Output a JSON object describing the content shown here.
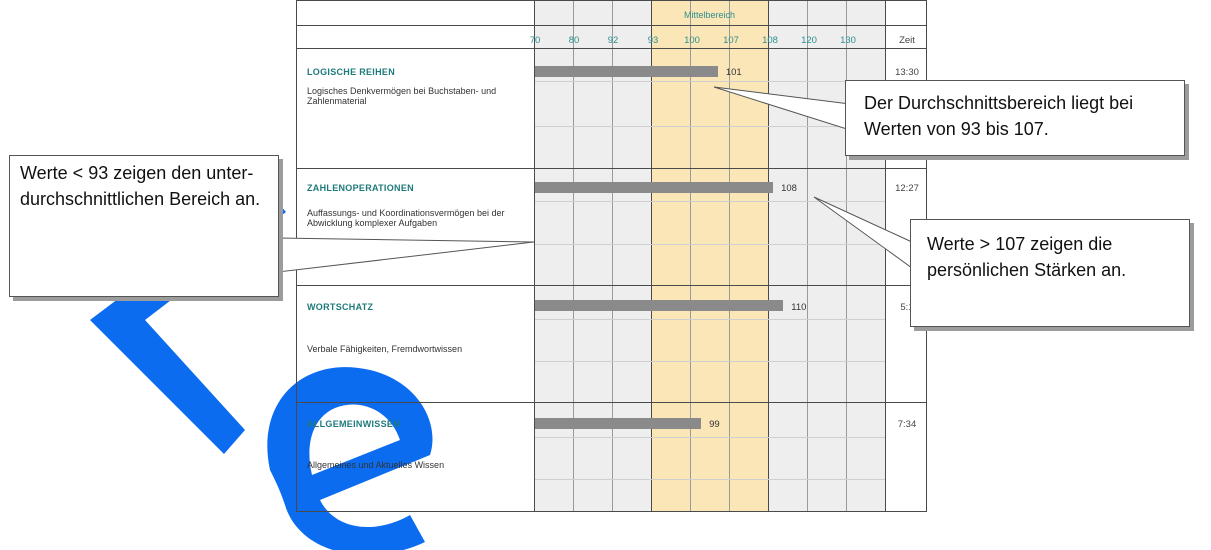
{
  "watermark": {
    "letters": "Le",
    "color": "#0b6cf0"
  },
  "table": {
    "header_band_label": "Mittelbereich",
    "zeit_label": "Zeit",
    "tick_labels": [
      "70",
      "80",
      "92",
      "93",
      "100",
      "107",
      "108",
      "120",
      "130"
    ]
  },
  "chart_data": {
    "type": "bar",
    "orientation": "horizontal",
    "categories": [
      "LOGISCHE REIHEN",
      "ZAHLENOPERATIONEN",
      "WORTSCHATZ",
      "ALLGEMEINWISSEN"
    ],
    "values": [
      101,
      108,
      110,
      99
    ],
    "average_range": [
      93,
      107
    ],
    "axis_ticks": [
      70,
      80,
      92,
      93,
      100,
      107,
      108,
      120,
      130
    ]
  },
  "sections": [
    {
      "title": "LOGISCHE REIHEN",
      "desc": "Logisches Denkvermögen bei Buchstaben- und Zahlenmaterial",
      "value": "101",
      "time": "13:30"
    },
    {
      "title": "ZAHLENOPERATIONEN",
      "desc": "Auffassungs- und Koordinationsvermögen bei der Abwicklung komplexer Aufgaben",
      "value": "108",
      "time": "12:27"
    },
    {
      "title": "WORTSCHATZ",
      "desc": "Verbale Fähigkeiten, Fremdwortwissen",
      "value": "110",
      "time": "5:1"
    },
    {
      "title": "ALLGEMEINWISSEN",
      "desc": "Allgemeines und Aktuelles Wissen",
      "value": "99",
      "time": "7:34"
    }
  ],
  "callouts": {
    "left_text": "Werte < 93 zeigen den unter-durchschnittlichen Bereich an.",
    "top_right_text": "Der Durchschnittsbereich liegt bei Werten von 93 bis 107.",
    "right_text": "Werte > 107 zeigen die persönlichen Stärken an."
  }
}
